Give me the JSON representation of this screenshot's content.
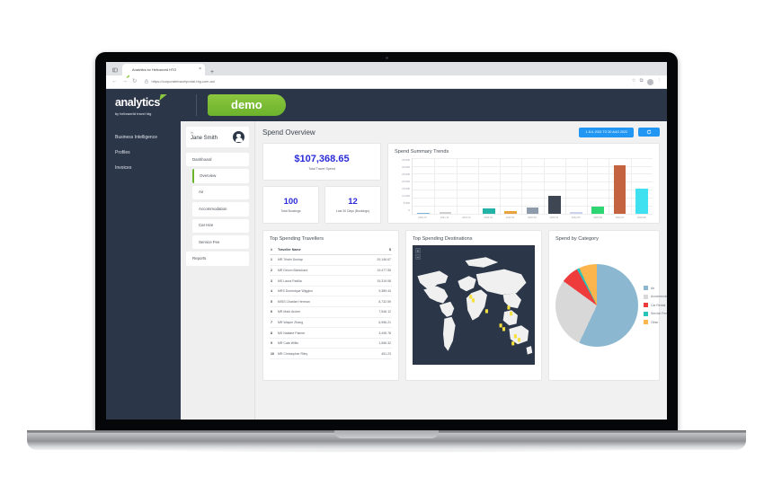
{
  "browser": {
    "tab_title": "Analytics by Helloworld HTG",
    "tab_close": "×",
    "new_tab": "+",
    "back": "←",
    "forward": "→",
    "reload": "↻",
    "lock": "⌂",
    "url": "https://corporatetravelportal.htg.com.au/",
    "favorite": "☆",
    "extensions": "⧉",
    "menu": "⋮"
  },
  "header": {
    "logo_word": "analytics",
    "logo_sub": "by helloworld travel htg",
    "demo_badge": "demo"
  },
  "nav_left": {
    "items": [
      {
        "label": "Business Intelligence"
      },
      {
        "label": "Profiles"
      },
      {
        "label": "Invoices"
      }
    ]
  },
  "menu": {
    "greeting": "Hi,",
    "user_name": "Jane Smith",
    "items": [
      {
        "label": "Dashboard",
        "active": false,
        "sub": false
      },
      {
        "label": "Overview",
        "active": true,
        "sub": true
      },
      {
        "label": "Air",
        "active": false,
        "sub": true
      },
      {
        "label": "Accommodation",
        "active": false,
        "sub": true
      },
      {
        "label": "Car Hire",
        "active": false,
        "sub": true
      },
      {
        "label": "Service Fee",
        "active": false,
        "sub": true
      },
      {
        "label": "Reports",
        "active": false,
        "sub": false
      }
    ]
  },
  "content": {
    "page_title": "Spend Overview",
    "date_range": "1 JUL 2021 TO 30 AUG 2022",
    "refresh_label": "Refresh",
    "kpi_total_spend": {
      "value": "$107,368.65",
      "label": "Total Travel Spend"
    },
    "kpi_total_bookings": {
      "value": "100",
      "label": "Total Bookings"
    },
    "kpi_last_30": {
      "value": "12",
      "label": "Last 30 Days (Bookings)"
    },
    "panel_trends_title": "Spend Summary Trends",
    "panel_travellers_title": "Top Spending Travellers",
    "panel_destinations_title": "Top Spending Destinations",
    "panel_category_title": "Spend by Category",
    "map_zoom_in": "+",
    "map_zoom_out": "−"
  },
  "travellers": {
    "columns": [
      "#",
      "Traveller Name",
      "$"
    ],
    "rows": [
      {
        "idx": "1",
        "name": "MR Tristin Dunlap",
        "amount": "29,146.67"
      },
      {
        "idx": "2",
        "name": "MR Devon Blanchard",
        "amount": "19,477.55"
      },
      {
        "idx": "3",
        "name": "MS Laura Padilla",
        "amount": "15,319.08"
      },
      {
        "idx": "4",
        "name": "MRS Dominique Wiggins",
        "amount": "9,389.44"
      },
      {
        "idx": "5",
        "name": "MISS Charlize Herman",
        "amount": "8,732.59"
      },
      {
        "idx": "6",
        "name": "MR Mark Archer",
        "amount": "7,546.12"
      },
      {
        "idx": "7",
        "name": "MR Wayne Zhang",
        "amount": "6,956.21"
      },
      {
        "idx": "8",
        "name": "MS Natalee Palmer",
        "amount": "3,495.78"
      },
      {
        "idx": "9",
        "name": "MR Cate Willis",
        "amount": "1,556.32"
      },
      {
        "idx": "10",
        "name": "MR Christopher Riley",
        "amount": "451.23"
      }
    ]
  },
  "chart_data": [
    {
      "type": "bar",
      "title": "Spend Summary Trends",
      "xlabel": "",
      "ylabel": "",
      "ylim": [
        0,
        35000
      ],
      "yticks": [
        "35,000",
        "30,000",
        "25,000",
        "20,000",
        "15,000",
        "10,000",
        "5,000",
        "0"
      ],
      "grid": true,
      "categories": [
        "2021-07",
        "2021-11",
        "2021-12",
        "2022-01",
        "2022-02",
        "2022-03",
        "2022-04",
        "2022-05",
        "2022-06",
        "2022-07",
        "2022-08"
      ],
      "values": [
        600,
        900,
        0,
        3400,
        1500,
        4200,
        11500,
        1100,
        4600,
        30500,
        15500
      ],
      "colors": [
        "#7fb3d5",
        "#cfcfcf",
        "#ffffff",
        "#22b3a6",
        "#e8a33d",
        "#8e9bab",
        "#3e4654",
        "#cdd2ee",
        "#2ed573",
        "#c4633f",
        "#3fe0f0"
      ]
    },
    {
      "type": "pie",
      "title": "Spend by Category",
      "legend_position": "right",
      "labels": [
        "Air",
        "Accommodation",
        "Car Rental",
        "Service Fees",
        "Other"
      ],
      "values": [
        57,
        28,
        7,
        1,
        7
      ],
      "colors": [
        "#8bb8d0",
        "#d8d8d8",
        "#ee3b3b",
        "#27c4bb",
        "#fcb44d"
      ]
    }
  ],
  "map": {
    "markers": [
      {
        "x": 47.5,
        "y": 43
      },
      {
        "x": 49.5,
        "y": 46
      },
      {
        "x": 60.5,
        "y": 55
      },
      {
        "x": 78.5,
        "y": 52
      },
      {
        "x": 80.5,
        "y": 57
      },
      {
        "x": 72.0,
        "y": 67
      },
      {
        "x": 74.5,
        "y": 70
      },
      {
        "x": 84.0,
        "y": 76
      },
      {
        "x": 87.0,
        "y": 79
      },
      {
        "x": 82.0,
        "y": 82
      }
    ]
  }
}
